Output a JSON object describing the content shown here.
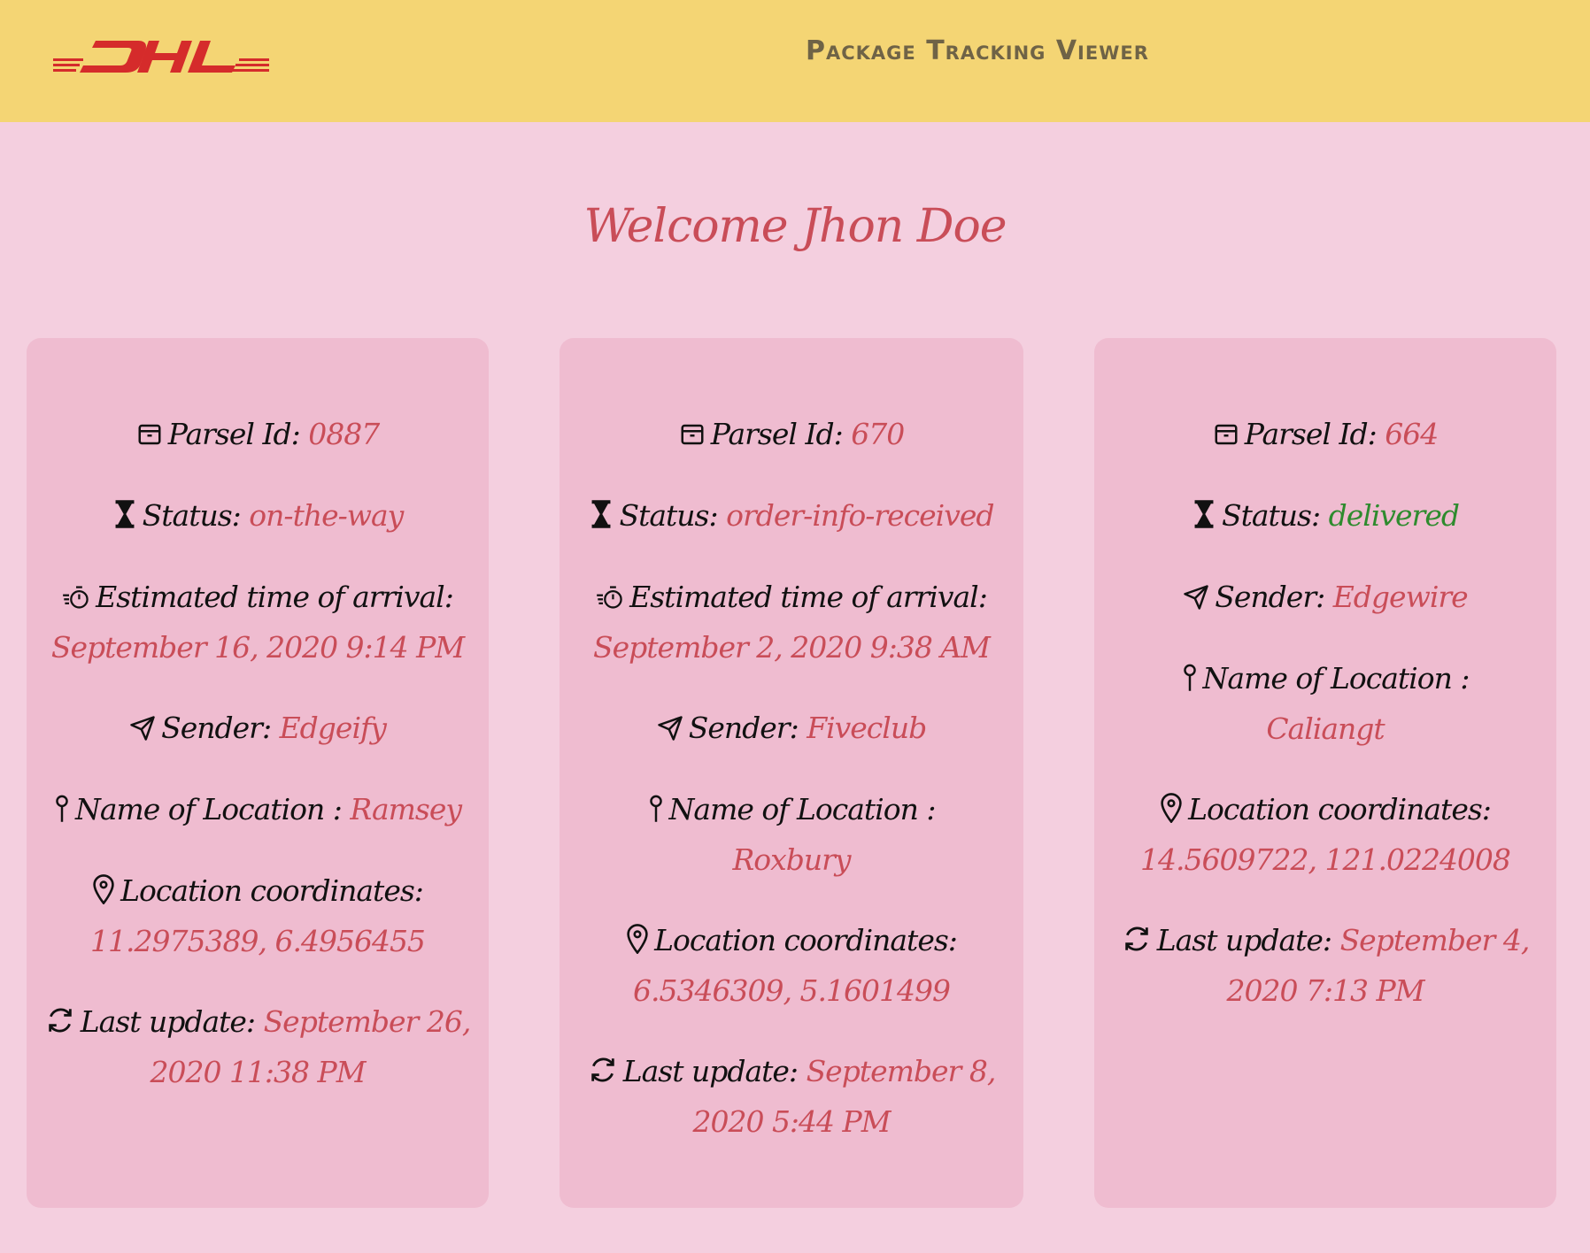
{
  "header": {
    "logo_text": "DHL",
    "title": "Package Tracking Viewer"
  },
  "welcome": "Welcome Jhon Doe",
  "colors": {
    "header_bg": "#f4d574",
    "page_bg": "#f4cfdf",
    "card_bg": "#efbcd0",
    "value": "#c94d58",
    "delivered": "#2e8b2e",
    "logo": "#d52b2b"
  },
  "labels": {
    "parcel_id": "Parsel Id:",
    "status": "Status:",
    "eta": "Estimated time of arrival:",
    "sender": "Sender:",
    "location_name": "Name of Location :",
    "coordinates": "Location coordinates:",
    "last_update": "Last update:"
  },
  "icons": {
    "parcel_id": "archive-box-icon",
    "status": "hourglass-icon",
    "eta": "timer-icon",
    "sender": "send-arrow-icon",
    "location_name": "pin-icon",
    "coordinates": "map-marker-icon",
    "last_update": "refresh-icon"
  },
  "parcels": [
    {
      "id": "0887",
      "status": "on-the-way",
      "eta": "September 16, 2020 9:14 PM",
      "sender": "Edgeify",
      "location_name": "Ramsey",
      "coordinates": "11.2975389, 6.4956455",
      "last_update_1": "September 26,",
      "last_update_2": "2020 11:38 PM"
    },
    {
      "id": "670",
      "status": "order-info-received",
      "eta": "September 2, 2020 9:38 AM",
      "sender": "Fiveclub",
      "location_name": "Roxbury",
      "coordinates": "6.5346309, 5.1601499",
      "last_update_1": "September 8,",
      "last_update_2": "2020 5:44 PM"
    },
    {
      "id": "664",
      "status": "delivered",
      "sender": "Edgewire",
      "location_name": "Caliangt",
      "coordinates": "14.5609722, 121.0224008",
      "last_update_1": "September 4,",
      "last_update_2": "2020 7:13 PM"
    }
  ]
}
